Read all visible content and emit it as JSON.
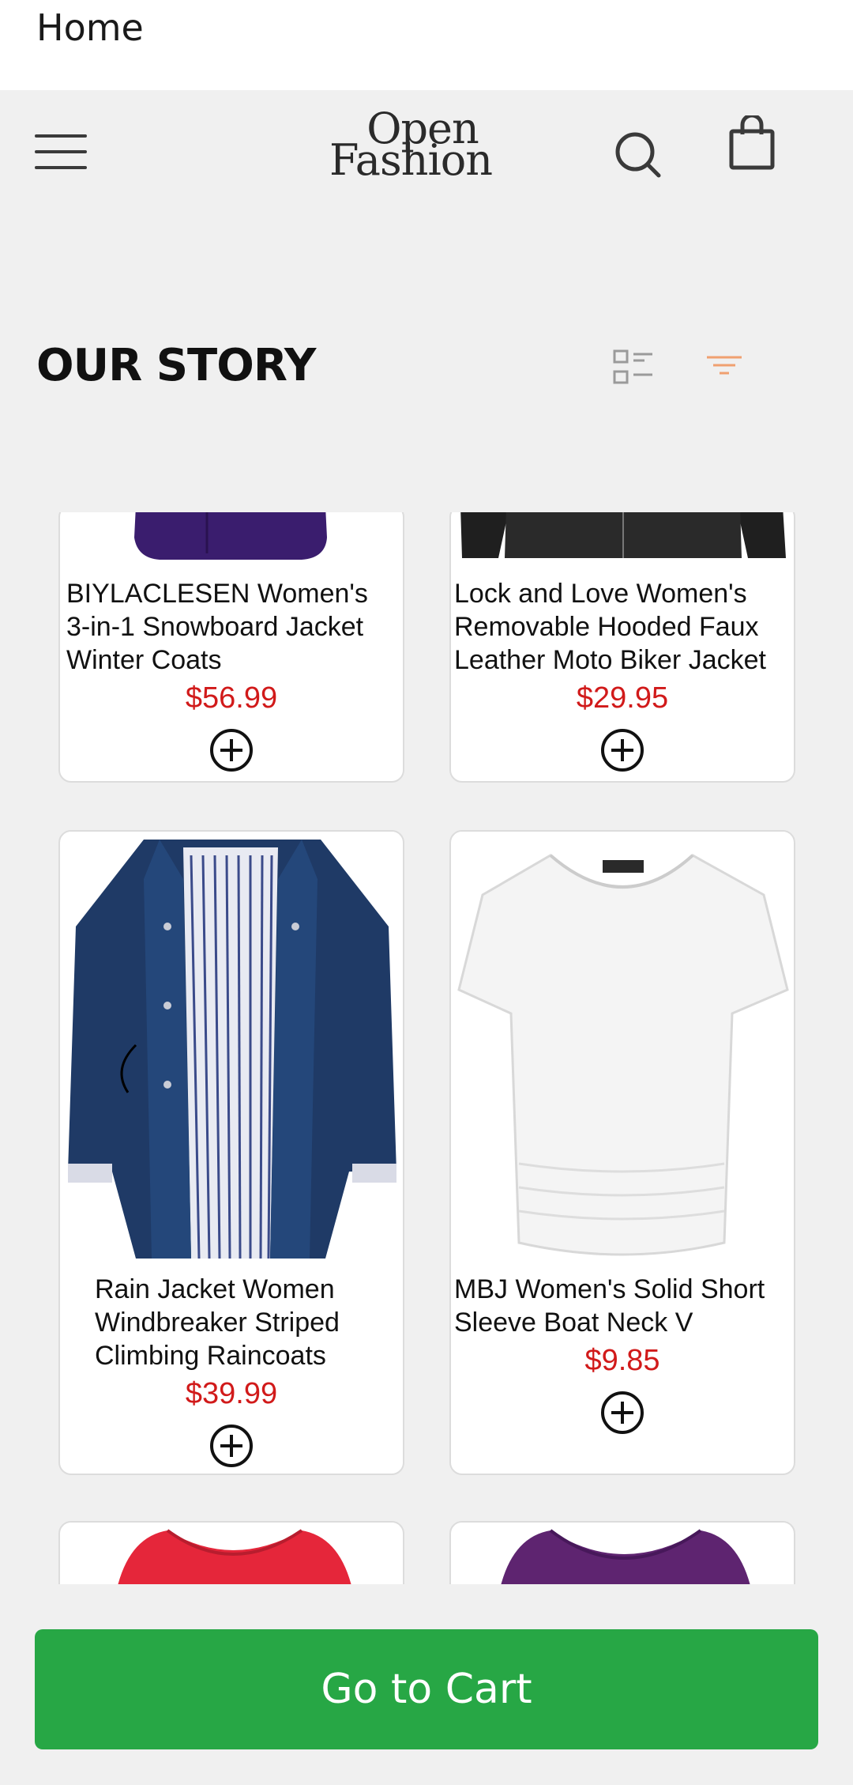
{
  "app": {
    "title": "Home"
  },
  "header": {
    "logo_line1": "Open",
    "logo_line2": "Fashion",
    "menu_icon": "hamburger-icon",
    "search_icon": "search-icon",
    "cart_icon": "shopping-bag-icon"
  },
  "section": {
    "title": "OUR STORY"
  },
  "products": [
    {
      "title": "BIYLACLESEN Women's 3-in-1 Snowboard Jacket Winter Coats",
      "price": "$56.99",
      "color": "#3a1d6e"
    },
    {
      "title": "Lock and Love Women's Removable Hooded Faux Leather Moto Biker Jacket",
      "price": "$29.95",
      "color": "#1f1f1f"
    },
    {
      "title": "Rain Jacket Women Windbreaker Striped Climbing Raincoats",
      "price": "$39.99",
      "color": "#1f3a66"
    },
    {
      "title": "MBJ Women's Solid Short Sleeve Boat Neck V",
      "price": "$9.85",
      "color": "#f7f7f7"
    },
    {
      "title": "",
      "price": "",
      "color": "#e5263a"
    },
    {
      "title": "",
      "price": "",
      "color": "#5e2470"
    }
  ],
  "footer": {
    "cart_button_label": "Go to Cart"
  },
  "colors": {
    "accent_green": "#27a745",
    "price_red": "#d11a1a",
    "filter_orange": "#f0a070"
  }
}
